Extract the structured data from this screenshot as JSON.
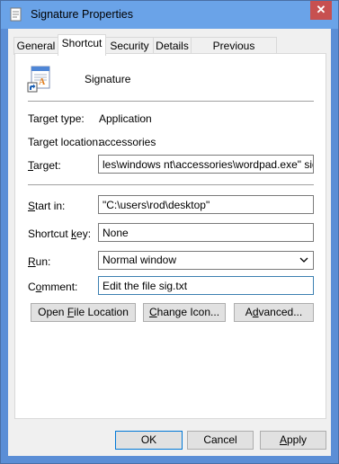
{
  "window": {
    "title": "Signature Properties",
    "close_glyph": "✕"
  },
  "tabs": [
    {
      "label": "General"
    },
    {
      "label": "Shortcut"
    },
    {
      "label": "Security"
    },
    {
      "label": "Details"
    },
    {
      "label": "Previous Versions"
    }
  ],
  "shortcut": {
    "name": "Signature",
    "target_type_label": "Target type:",
    "target_type_value": "Application",
    "target_location_label": "Target location:",
    "target_location_value": "accessories",
    "target_label_pre": "",
    "target_label_ul": "T",
    "target_label_post": "arget:",
    "target_value": "les\\windows nt\\accessories\\wordpad.exe\" sig.txt",
    "start_in_label_pre": "",
    "start_in_label_ul": "S",
    "start_in_label_post": "tart in:",
    "start_in_value": "\"C:\\users\\rod\\desktop\"",
    "shortcut_key_label_pre": "Shortcut ",
    "shortcut_key_label_ul": "k",
    "shortcut_key_label_post": "ey:",
    "shortcut_key_value": "None",
    "run_label_pre": "",
    "run_label_ul": "R",
    "run_label_post": "un:",
    "run_value": "Normal window",
    "comment_label_pre": "C",
    "comment_label_ul": "o",
    "comment_label_post": "mment:",
    "comment_value": "Edit the file sig.txt"
  },
  "actions": {
    "open_location_pre": "Open ",
    "open_location_ul": "F",
    "open_location_post": "ile Location",
    "change_icon_pre": "",
    "change_icon_ul": "C",
    "change_icon_post": "hange Icon...",
    "advanced_pre": "A",
    "advanced_ul": "d",
    "advanced_post": "vanced..."
  },
  "footer": {
    "ok": "OK",
    "cancel": "Cancel",
    "apply_pre": "",
    "apply_ul": "A",
    "apply_post": "pply"
  },
  "icons": {
    "shortcut": "wordpad-shortcut-icon",
    "title": "properties-icon",
    "dropdown": "chevron-down-icon"
  }
}
